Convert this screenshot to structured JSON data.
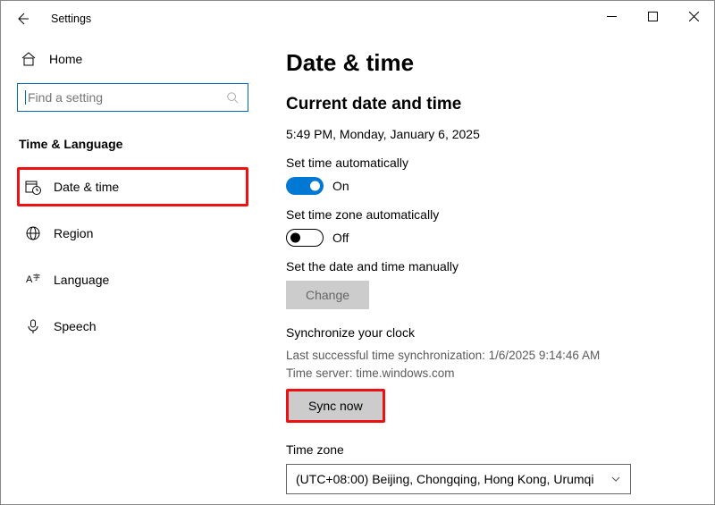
{
  "window": {
    "title": "Settings"
  },
  "sidebar": {
    "home": "Home",
    "search_placeholder": "Find a setting",
    "section": "Time & Language",
    "items": [
      {
        "label": "Date & time"
      },
      {
        "label": "Region"
      },
      {
        "label": "Language"
      },
      {
        "label": "Speech"
      }
    ]
  },
  "page": {
    "title": "Date & time",
    "current_heading": "Current date and time",
    "current_value": "5:49 PM, Monday, January 6, 2025",
    "auto_time": {
      "label": "Set time automatically",
      "state": "On"
    },
    "auto_tz": {
      "label": "Set time zone automatically",
      "state": "Off"
    },
    "manual": {
      "label": "Set the date and time manually",
      "button": "Change"
    },
    "sync": {
      "heading": "Synchronize your clock",
      "last": "Last successful time synchronization: 1/6/2025 9:14:46 AM",
      "server": "Time server: time.windows.com",
      "button": "Sync now"
    },
    "tz": {
      "label": "Time zone",
      "value": "(UTC+08:00) Beijing, Chongqing, Hong Kong, Urumqi"
    }
  }
}
